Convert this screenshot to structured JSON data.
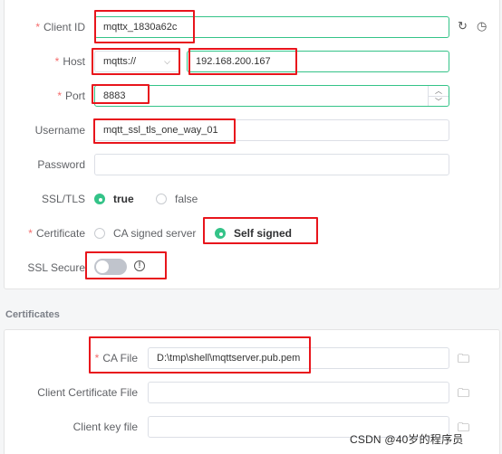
{
  "connection": {
    "client_id": {
      "label": "Client ID",
      "value": "mqttx_1830a62c"
    },
    "host": {
      "label": "Host",
      "protocol": "mqtts://",
      "value": "192.168.200.167"
    },
    "port": {
      "label": "Port",
      "value": "8883"
    },
    "username": {
      "label": "Username",
      "value": "mqtt_ssl_tls_one_way_01"
    },
    "password": {
      "label": "Password",
      "value": ""
    },
    "ssl_tls": {
      "label": "SSL/TLS",
      "options": [
        "true",
        "false"
      ],
      "selected": "true"
    },
    "certificate": {
      "label": "Certificate",
      "options": [
        "CA signed server",
        "Self signed"
      ],
      "selected": "Self signed"
    },
    "ssl_secure": {
      "label": "SSL Secure",
      "enabled": false
    }
  },
  "certificates": {
    "section_title": "Certificates",
    "ca_file": {
      "label": "CA File",
      "value": "D:\\tmp\\shell\\mqttserver.pub.pem"
    },
    "client_certificate_file": {
      "label": "Client Certificate File",
      "value": ""
    },
    "client_key_file": {
      "label": "Client key file",
      "value": ""
    }
  },
  "watermark": "CSDN @40岁的程序员",
  "colors": {
    "accent": "#34c388",
    "highlight": "#e8151c",
    "required": "#f56c6c"
  },
  "icons": [
    "refresh-icon",
    "clock-icon",
    "chevron-down-icon",
    "stepper-up-icon",
    "stepper-down-icon",
    "info-icon",
    "folder-icon"
  ]
}
